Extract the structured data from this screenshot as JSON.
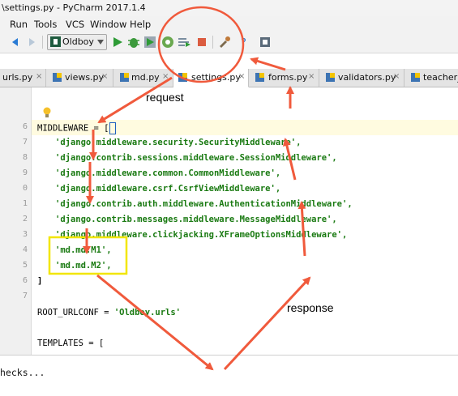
{
  "window": {
    "title": "\\settings.py - PyCharm 2017.1.4"
  },
  "menu": [
    "Run",
    "Tools",
    "VCS",
    "Window",
    "Help"
  ],
  "toolbar": {
    "run_config": "Oldboy",
    "icons": [
      "back-icon",
      "forward-icon",
      "run-icon",
      "debug-icon",
      "coverage-icon",
      "profile-icon",
      "concurrency-icon",
      "stop-icon",
      "build-icon",
      "help-icon",
      "sdk-icon"
    ]
  },
  "tabs": [
    {
      "label": "urls.py",
      "active": false
    },
    {
      "label": "views.py",
      "active": false
    },
    {
      "label": "md.py",
      "active": false
    },
    {
      "label": "settings.py",
      "active": true
    },
    {
      "label": "forms.py",
      "active": false
    },
    {
      "label": "validators.py",
      "active": false
    },
    {
      "label": "teacher_",
      "active": false
    }
  ],
  "editor": {
    "line_numbers": [
      "6",
      "7",
      "8",
      "9",
      "0",
      "1",
      "2",
      "3",
      "4",
      "5",
      "6",
      "7"
    ],
    "middleware_decl": "MIDDLEWARE = [",
    "middleware": [
      "'django.middleware.security.SecurityMiddleware',",
      "'django.contrib.sessions.middleware.SessionMiddleware',",
      "'django.middleware.common.CommonMiddleware',",
      "'django.middleware.csrf.CsrfViewMiddleware',",
      "'django.contrib.auth.middleware.AuthenticationMiddleware',",
      "'django.contrib.messages.middleware.MessageMiddleware',",
      "'django.middleware.clickjacking.XFrameOptionsMiddleware',",
      "'md.md.M1',",
      "'md.md.M2',"
    ],
    "close_bracket": "]",
    "root_urlconf_key": "ROOT_URLCONF = ",
    "root_urlconf_val": "'Oldboy.urls'",
    "templates": "TEMPLATES = ["
  },
  "bottom_panel": {
    "text": "hecks..."
  },
  "annotations": {
    "request": "request",
    "response": "response"
  },
  "colors": {
    "arrow": "#f05a3c",
    "highlight_box": "#f2e600",
    "string": "#1a7a12"
  }
}
